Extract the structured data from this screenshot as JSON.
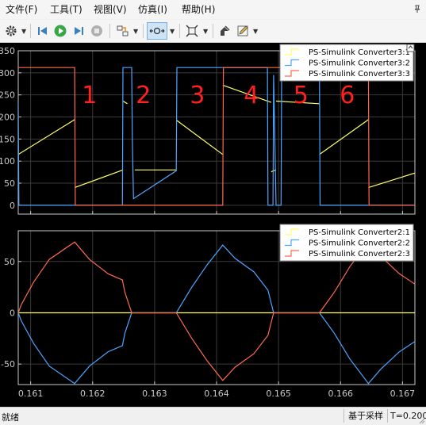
{
  "menu": [
    "文件(F)",
    "工具(T)",
    "视图(V)",
    "仿真(I)",
    "帮助(H)"
  ],
  "toolbar": {
    "buttons": [
      "gear-icon",
      "step-back-icon",
      "run-icon",
      "step-forward-icon",
      "stop-icon",
      "highlight-icon",
      "zoom-icon",
      "fit-icon",
      "style-icon",
      "edit-icon"
    ]
  },
  "status": {
    "left": "就绪",
    "mode": "基于采样",
    "time": "T=0.200"
  },
  "colors": {
    "yellow": "#ffff66",
    "blue": "#4da6ff",
    "orange": "#ff6a4d",
    "background": "#000000",
    "axis": "#c8c8c8",
    "grid": "#3a3a3a",
    "annotation": "#ff2020"
  },
  "chart_data": [
    {
      "type": "line",
      "xlim": [
        0.1608,
        0.1672
      ],
      "ylim": [
        -20,
        350
      ],
      "yticks": [
        0,
        50,
        100,
        150,
        200,
        250,
        300,
        350
      ],
      "grid": true,
      "legend_position": "top-right",
      "annotations": [
        {
          "text": "1",
          "x": 0.16195
        },
        {
          "text": "2",
          "x": 0.16282
        },
        {
          "text": "3",
          "x": 0.16369
        },
        {
          "text": "4",
          "x": 0.16456
        },
        {
          "text": "5",
          "x": 0.16536
        },
        {
          "text": "6",
          "x": 0.16611
        }
      ],
      "series": [
        {
          "name": "PS-Simulink Converter3:1",
          "color": "yellow",
          "segments": [
            [
              [
                0.1608,
                115
              ],
              [
                0.16171,
                194
              ]
            ],
            [
              [
                0.16171,
                40
              ],
              [
                0.16249,
                80
              ]
            ],
            [
              [
                0.16249,
                236
              ],
              [
                0.16256,
                230
              ]
            ],
            [
              [
                0.16268,
                80
              ],
              [
                0.16335,
                80
              ]
            ],
            [
              [
                0.16335,
                193
              ],
              [
                0.1641,
                115
              ]
            ],
            [
              [
                0.1641,
                272
              ],
              [
                0.16488,
                233
              ]
            ],
            [
              [
                0.16488,
                76
              ],
              [
                0.16496,
                80
              ]
            ],
            [
              [
                0.16496,
                236
              ],
              [
                0.16566,
                230
              ]
            ],
            [
              [
                0.16566,
                115
              ],
              [
                0.16645,
                194
              ]
            ],
            [
              [
                0.16645,
                40
              ],
              [
                0.1672,
                73
              ]
            ]
          ]
        },
        {
          "name": "PS-Simulink Converter3:2",
          "color": "blue",
          "points": [
            [
              0.1608,
              232
            ],
            [
              0.16081,
              0
            ],
            [
              0.16248,
              0
            ],
            [
              0.16249,
              312
            ],
            [
              0.16263,
              312
            ],
            [
              0.16264,
              150
            ],
            [
              0.16266,
              15
            ],
            [
              0.16335,
              78
            ],
            [
              0.16336,
              312
            ],
            [
              0.16482,
              312
            ],
            [
              0.16483,
              0
            ],
            [
              0.16491,
              0
            ],
            [
              0.16492,
              295
            ],
            [
              0.16496,
              0
            ],
            [
              0.16504,
              0
            ],
            [
              0.16505,
              298
            ],
            [
              0.16566,
              298
            ],
            [
              0.16567,
              0
            ],
            [
              0.1672,
              0
            ]
          ]
        },
        {
          "name": "PS-Simulink Converter3:3",
          "color": "orange",
          "points": [
            [
              0.1608,
              312
            ],
            [
              0.16171,
              312
            ],
            [
              0.16172,
              0
            ],
            [
              0.1641,
              0
            ],
            [
              0.16411,
              312
            ],
            [
              0.16645,
              312
            ],
            [
              0.16646,
              0
            ],
            [
              0.1672,
              0
            ]
          ]
        }
      ]
    },
    {
      "type": "line",
      "xlim": [
        0.1608,
        0.1672
      ],
      "ylim": [
        -70,
        80
      ],
      "yticks": [
        -50,
        0,
        50
      ],
      "xticks": [
        0.161,
        0.162,
        0.163,
        0.164,
        0.165,
        0.166,
        0.167
      ],
      "grid": true,
      "legend_position": "top-right",
      "series": [
        {
          "name": "PS-Simulink Converter2:1",
          "color": "yellow",
          "points": [
            [
              0.1608,
              0
            ],
            [
              0.1672,
              0
            ]
          ]
        },
        {
          "name": "PS-Simulink Converter2:2",
          "color": "blue",
          "points": [
            [
              0.1608,
              0
            ],
            [
              0.16085,
              -8
            ],
            [
              0.16105,
              -30
            ],
            [
              0.1613,
              -52
            ],
            [
              0.16171,
              -69
            ],
            [
              0.16195,
              -52
            ],
            [
              0.16225,
              -38
            ],
            [
              0.16248,
              -32
            ],
            [
              0.16252,
              -20
            ],
            [
              0.16263,
              0
            ],
            [
              0.16335,
              0
            ],
            [
              0.1636,
              25
            ],
            [
              0.16385,
              47
            ],
            [
              0.1641,
              66
            ],
            [
              0.1643,
              53
            ],
            [
              0.1646,
              40
            ],
            [
              0.16483,
              22
            ],
            [
              0.16492,
              0
            ],
            [
              0.16566,
              0
            ],
            [
              0.1659,
              -20
            ],
            [
              0.16615,
              -45
            ],
            [
              0.16645,
              -69
            ],
            [
              0.16665,
              -55
            ],
            [
              0.16695,
              -38
            ],
            [
              0.1672,
              -28
            ]
          ]
        },
        {
          "name": "PS-Simulink Converter2:3",
          "color": "orange",
          "points": [
            [
              0.1608,
              0
            ],
            [
              0.16085,
              8
            ],
            [
              0.16105,
              30
            ],
            [
              0.1613,
              52
            ],
            [
              0.16171,
              69
            ],
            [
              0.16195,
              52
            ],
            [
              0.16225,
              38
            ],
            [
              0.16248,
              32
            ],
            [
              0.16252,
              20
            ],
            [
              0.16263,
              0
            ],
            [
              0.16335,
              0
            ],
            [
              0.1636,
              -25
            ],
            [
              0.16385,
              -47
            ],
            [
              0.1641,
              -66
            ],
            [
              0.1643,
              -53
            ],
            [
              0.1646,
              -40
            ],
            [
              0.16483,
              -22
            ],
            [
              0.16492,
              0
            ],
            [
              0.16566,
              0
            ],
            [
              0.1659,
              20
            ],
            [
              0.16615,
              45
            ],
            [
              0.16645,
              69
            ],
            [
              0.16665,
              55
            ],
            [
              0.16695,
              38
            ],
            [
              0.1672,
              28
            ]
          ]
        }
      ]
    }
  ]
}
